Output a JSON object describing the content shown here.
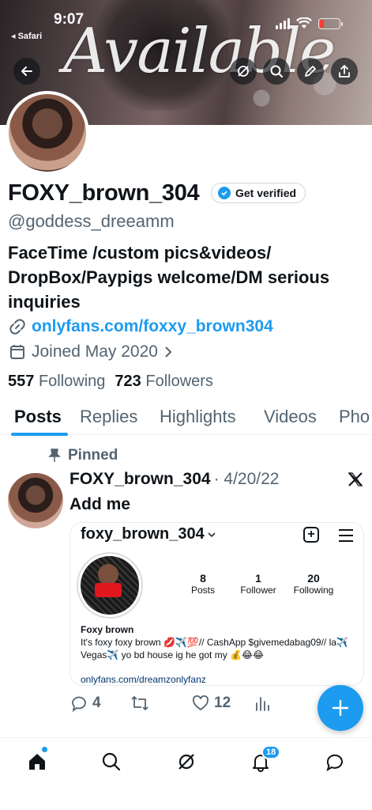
{
  "status_bar": {
    "time": "9:07",
    "back_app": "◂ Safari"
  },
  "banner": {
    "text": "Available"
  },
  "profile": {
    "display_name": "FOXY_brown_304",
    "verify_label": "Get verified",
    "handle": "@goddess_dreeamm",
    "bio": "FaceTime /custom pics&videos/ DropBox/Paypigs welcome/DM serious inquiries",
    "link": "onlyfans.com/foxxy_brown304",
    "joined": "Joined May 2020",
    "following_count": "557",
    "following_label": "Following",
    "followers_count": "723",
    "followers_label": "Followers"
  },
  "tabs": [
    "Posts",
    "Replies",
    "Highlights",
    "Videos",
    "Pho"
  ],
  "tweet": {
    "pinned_label": "Pinned",
    "author": "FOXY_brown_304",
    "date": "· 4/20/22",
    "text": "Add me",
    "replies": "4",
    "likes": "12"
  },
  "embed": {
    "username": "foxy_brown_304",
    "posts_count": "8",
    "posts_label": "Posts",
    "followers_count": "1",
    "followers_label": "Follower",
    "following_count": "20",
    "following_label": "Following",
    "full_name": "Foxy brown",
    "bio": "It's foxy foxy brown 💋✈️💯// CashApp $givemedabag09// la✈️ Vegas✈️ yo bd house ig he got my 💰😂😂",
    "link": "onlyfans.com/dreamzonlyfanz"
  },
  "nav": {
    "notifications_badge": "18"
  },
  "colors": {
    "accent": "#1d9bf0",
    "secondary_text": "#536471",
    "primary_text": "#0f1419"
  }
}
